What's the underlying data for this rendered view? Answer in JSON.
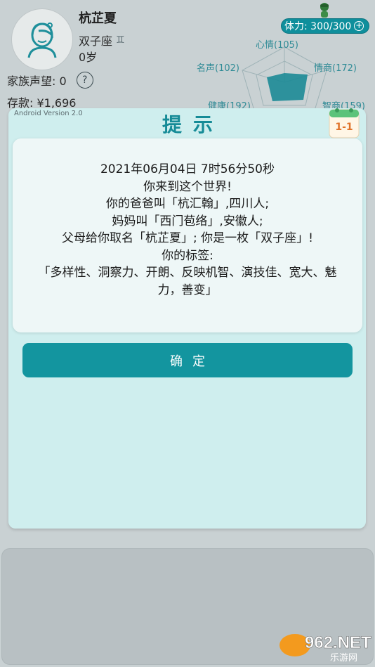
{
  "player": {
    "name": "杭芷夏",
    "zodiac": "双子座",
    "zodiac_symbol": "♊",
    "age": "0岁",
    "reputation_label": "家族声望: 0",
    "help_symbol": "?",
    "savings": "存款: ¥1,696"
  },
  "stamina": {
    "label": "体力: 300/300",
    "plus": "+"
  },
  "radar": {
    "labels": {
      "top": "心情(105)",
      "upper_left": "名声(102)",
      "upper_right": "情商(172)",
      "lower_left": "健康(192)",
      "lower_right": "智商(159)"
    }
  },
  "dialog": {
    "version": "Android Version 2.0",
    "title": "提示",
    "calendar": "1-1",
    "lines": [
      "2021年06月04日 7时56分50秒",
      "你来到这个世界!",
      "你的爸爸叫「杭汇翰」,四川人;",
      "妈妈叫「西门苞络」,安徽人;",
      "父母给你取名「杭芷夏」; 你是一枚「双子座」!",
      "你的标签:",
      "「多样性、洞察力、开朗、反映机智、演技佳、宽大、魅",
      "力，善变」"
    ],
    "confirm_label": "确定"
  },
  "watermark": {
    "line1": "962.NET",
    "line2": "乐游网"
  },
  "colors": {
    "accent": "#13959f",
    "dialog_bg": "#cfeeee",
    "radar_fill": "#1c8a96"
  }
}
